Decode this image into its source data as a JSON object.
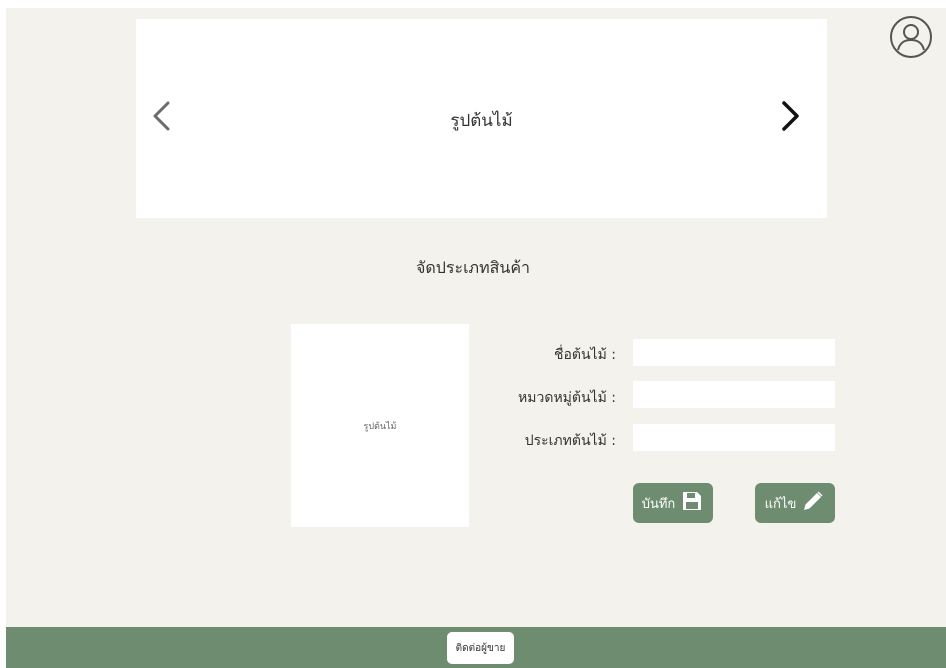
{
  "banner": {
    "title": "รูปต้นไม้",
    "prev_icon": "chevron-left-icon",
    "next_icon": "chevron-right-icon"
  },
  "header": {
    "profile_icon": "user-profile-icon"
  },
  "section": {
    "title": "จัดประเภทสินค้า"
  },
  "product_image": {
    "placeholder_text": "รูปต้นไม้"
  },
  "form": {
    "fields": [
      {
        "label": "ชื่อต้นไม้ :",
        "value": ""
      },
      {
        "label": "หมวดหมู่ต้นไม้ :",
        "value": ""
      },
      {
        "label": "ประเภทต้นไม้ :",
        "value": ""
      }
    ]
  },
  "actions": {
    "save_label": "บันทึก",
    "save_icon": "floppy-disk-icon",
    "edit_label": "แก้ไข",
    "edit_icon": "pencil-icon"
  },
  "footer": {
    "contact_label": "ติดต่อผู้ขาย"
  },
  "colors": {
    "background": "#f3f2ec",
    "accent": "#6e8c6f",
    "panel": "#ffffff"
  }
}
